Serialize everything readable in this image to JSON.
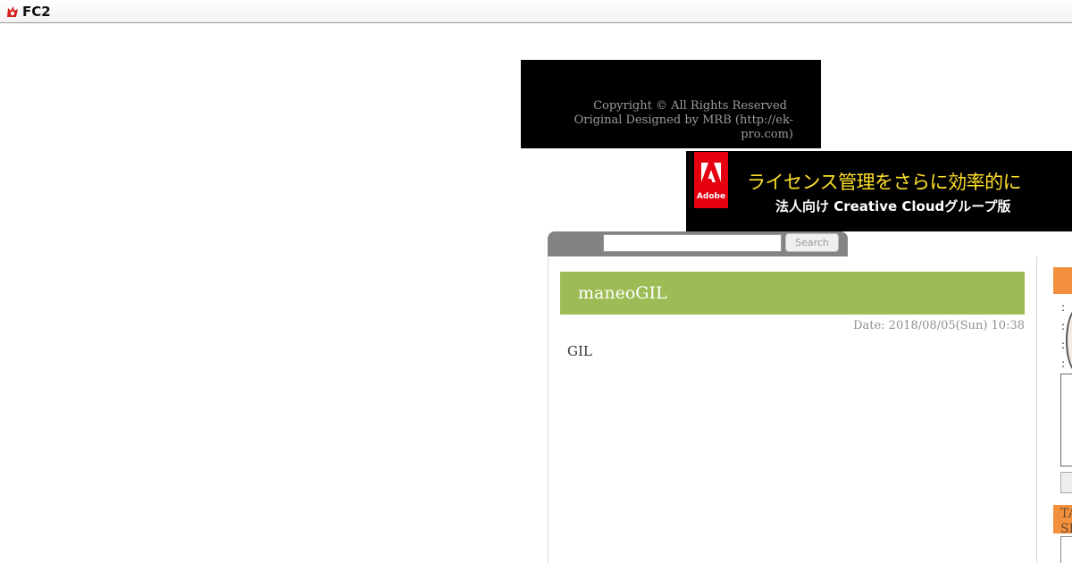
{
  "topbar": {
    "logo_text": "FC2",
    "logo_icon": "fc2-cat-icon"
  },
  "footer": {
    "copyright": "Copyright © All Rights Reserved",
    "designed_by": "Original Designed by MRB (http://ek-pro.com)"
  },
  "ad": {
    "brand": "Adobe",
    "headline": "ライセンス管理をさらに効率的に",
    "subline": "法人向け Creative Cloudグループ版",
    "colors": {
      "background": "#000000",
      "headline": "#ffe02a",
      "logo": "#e4000f"
    }
  },
  "search": {
    "value": "",
    "placeholder": "",
    "button_label": "Search"
  },
  "post": {
    "title": "maneoGIL",
    "date": "Date: 2018/08/05(Sun) 10:38",
    "body": "GIL",
    "title_bar_color": "#9dbc55"
  },
  "sidebar": {
    "colons": [
      ":",
      ":",
      ":",
      ":"
    ],
    "tag_label_1": "TA",
    "tag_label_2": "SE",
    "accent_color": "#f2903d"
  }
}
